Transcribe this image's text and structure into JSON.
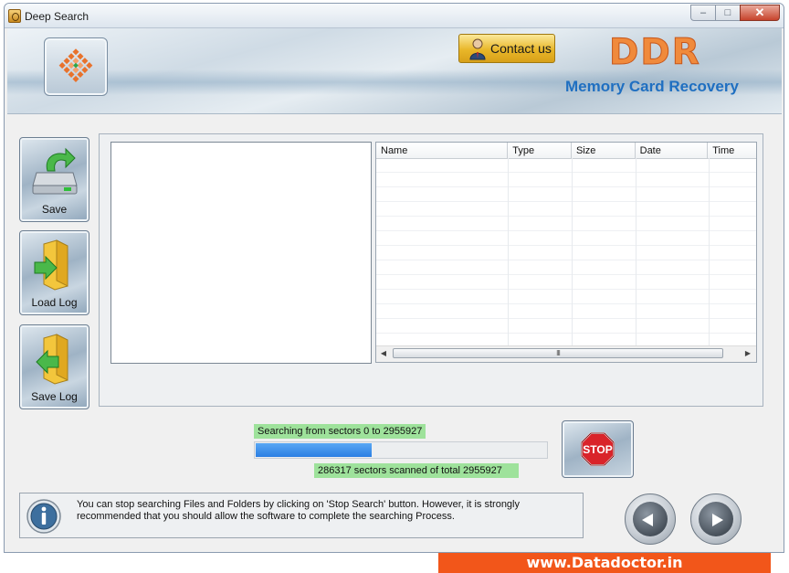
{
  "window": {
    "title": "Deep Search",
    "controls": {
      "minimize": "–",
      "maximize": "□",
      "close": "✕"
    }
  },
  "banner": {
    "contact_label": "Contact us",
    "brand": "DDR",
    "product": "Memory Card Recovery"
  },
  "sidebar": {
    "save_label": "Save",
    "load_log_label": "Load Log",
    "save_log_label": "Save Log"
  },
  "file_list": {
    "columns": [
      "Name",
      "Type",
      "Size",
      "Date",
      "Time"
    ],
    "scroll_grip": "III",
    "scroll_left": "◀",
    "scroll_right": "▶"
  },
  "progress": {
    "searching_prefix": "Searching from sectors 0 to",
    "total_sectors": "2955927",
    "scanned_sectors": "286317",
    "scanned_mid": "sectors scanned of total",
    "fraction": 0.4
  },
  "stop_label": "STOP",
  "info_text": "You can stop searching Files and Folders by clicking on 'Stop Search' button. However, it is strongly recommended that you should allow the software to complete the searching Process.",
  "footer": "www.Datadoctor.in",
  "colors": {
    "accent_orange": "#f2561a",
    "progress_blue": "#2b7fe3",
    "status_green": "#9ee29b",
    "brand_orange": "#f08a3c",
    "product_blue": "#1f6fc1"
  },
  "icons": {
    "logo": "mosaic-logo-icon",
    "contact": "person-icon",
    "save": "drive-save-icon",
    "load_log": "folder-load-icon",
    "save_log": "folder-save-icon",
    "stop": "stop-sign-icon",
    "info": "info-icon",
    "back": "back-arrow-icon",
    "next": "next-arrow-icon"
  }
}
